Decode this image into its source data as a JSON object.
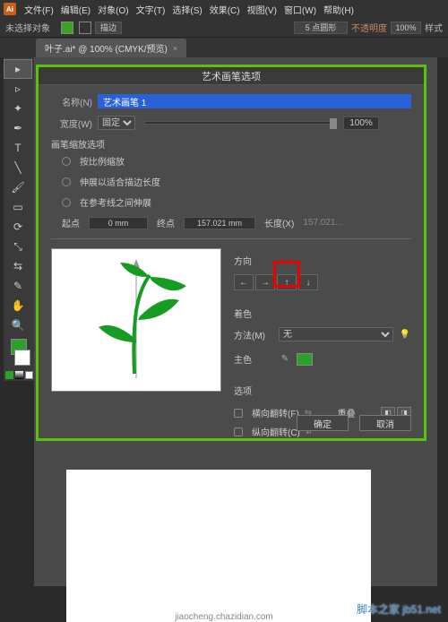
{
  "menu": {
    "items": [
      "文件(F)",
      "编辑(E)",
      "对象(O)",
      "文字(T)",
      "选择(S)",
      "效果(C)",
      "视图(V)",
      "窗口(W)",
      "帮助(H)"
    ]
  },
  "ctrlbar": {
    "status": "未选择对象",
    "stroke_btn": "描边",
    "brush_opt": "5 点圆形",
    "brush_mode": "不透明度",
    "opacity": "100%",
    "style": "样式"
  },
  "doctab": {
    "title": "叶子.ai* @ 100% (CMYK/预览)",
    "close": "×"
  },
  "dialog": {
    "title": "艺术画笔选项",
    "name_label": "名称(N)",
    "name_value": "艺术画笔 1",
    "width_label": "宽度(W)",
    "width_mode": "固定",
    "width_pct": "100%",
    "scale_hdr": "画笔缩放选项",
    "opt1": "按比例缩放",
    "opt2": "伸展以适合描边长度",
    "opt3": "在参考线之间伸展",
    "start_lbl": "起点",
    "start_val": "0 mm",
    "end_lbl": "终点",
    "end_val": "157.021 mm",
    "len_lbl": "长度(X)",
    "len_val": "157.021...",
    "direction_hdr": "方向",
    "color_hdr": "着色",
    "method_lbl": "方法(M)",
    "method_val": "无",
    "main_color_lbl": "主色",
    "options_hdr": "选项",
    "flip_h": "横向翻转(F)",
    "flip_v": "纵向翻转(C)",
    "overlap_lbl": "重叠",
    "ok": "确定",
    "cancel": "取消"
  },
  "watermark": "脚本之家 jb51.net",
  "wm2": "jiaocheng.chazidian.com"
}
